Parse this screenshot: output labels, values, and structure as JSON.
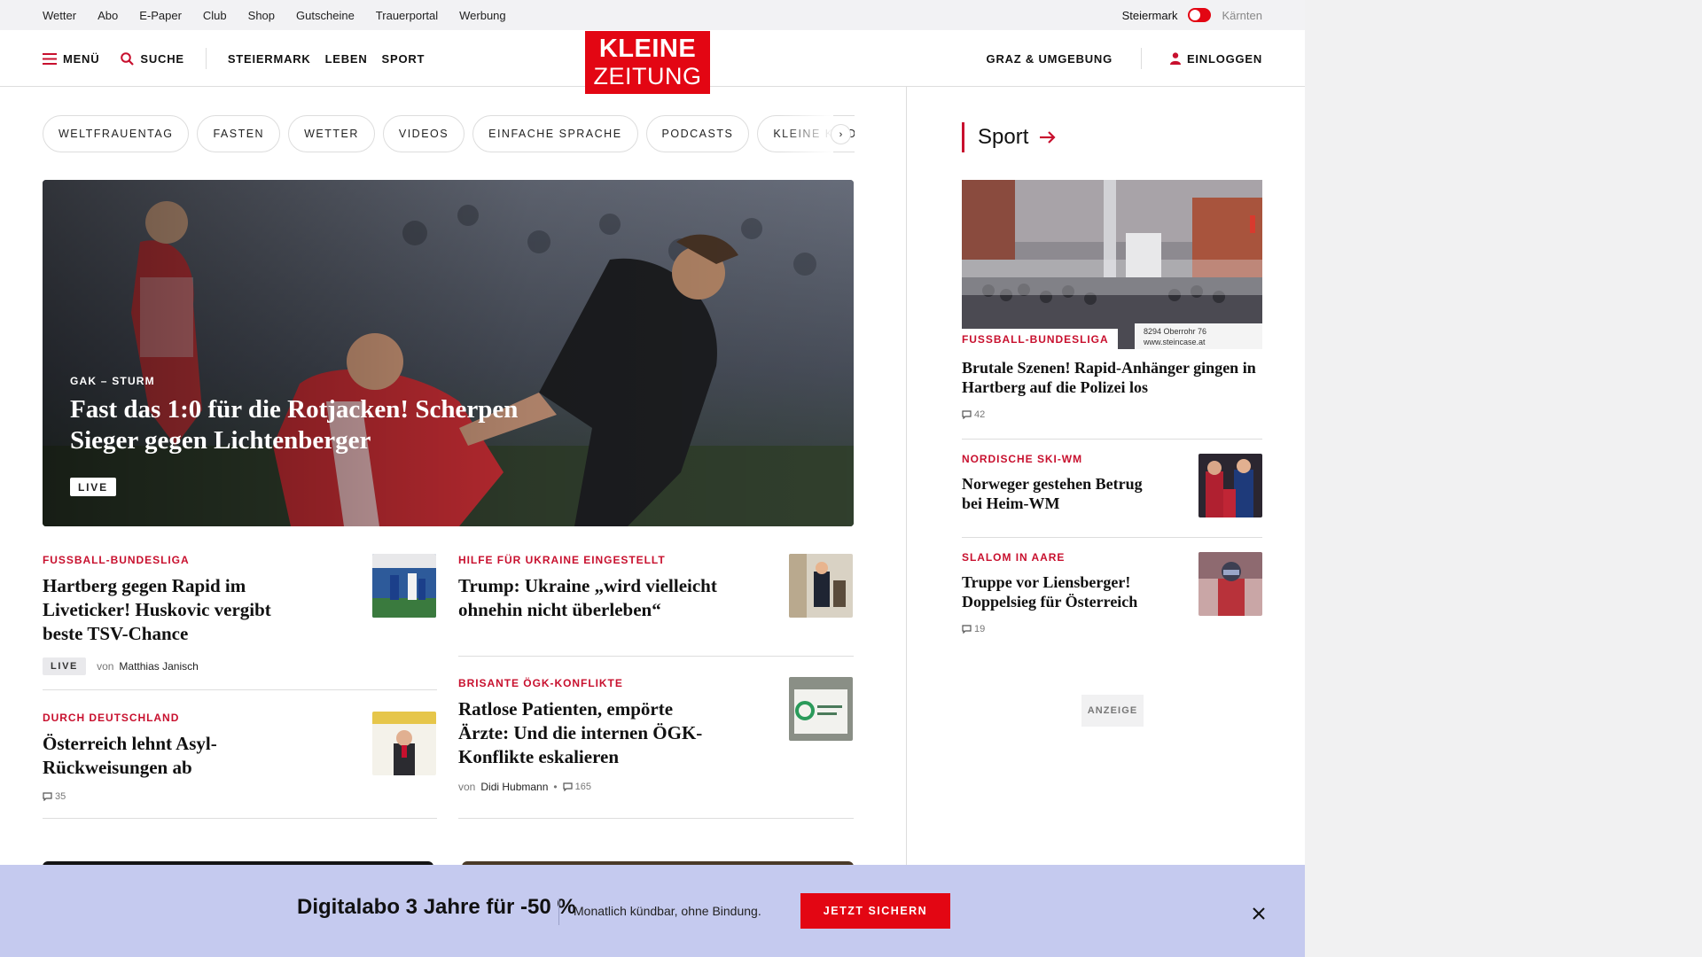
{
  "utility": {
    "links": [
      "Wetter",
      "Abo",
      "E-Paper",
      "Club",
      "Shop",
      "Gutscheine",
      "Trauerportal",
      "Werbung"
    ],
    "region_active": "Steiermark",
    "region_inactive": "Kärnten"
  },
  "header": {
    "menu": "MENÜ",
    "search": "SUCHE",
    "nav": [
      "STEIERMARK",
      "LEBEN",
      "SPORT"
    ],
    "logo_line1": "KLEINE",
    "logo_line2": "ZEITUNG",
    "region_link": "GRAZ & UMGEBUNG",
    "login": "EINLOGGEN"
  },
  "pills": [
    "WELTFRAUENTAG",
    "FASTEN",
    "WETTER",
    "VIDEOS",
    "EINFACHE SPRACHE",
    "PODCASTS",
    "KLEINE KINDERZEITUNG"
  ],
  "hero": {
    "kicker": "GAK – STURM",
    "title": "Fast das 1:0 für die Rotjacken! Scherpen Sieger gegen Lichtenberger",
    "badge": "LIVE"
  },
  "articles": {
    "a1": {
      "kicker": "FUSSBALL-BUNDESLIGA",
      "title": "Hartberg gegen Rapid im Liveticker! Huskovic vergibt beste TSV-Chance",
      "badge": "LIVE",
      "by": "von",
      "author": "Matthias Janisch"
    },
    "a2": {
      "kicker": "HILFE FÜR UKRAINE EINGESTELLT",
      "title": "Trump: Ukraine „wird vielleicht ohnehin nicht überleben“"
    },
    "a3": {
      "kicker": "DURCH DEUTSCHLAND",
      "title": "Österreich lehnt Asyl-Rückweisungen ab",
      "comments": "35"
    },
    "a4": {
      "kicker": "BRISANTE ÖGK-KONFLIKTE",
      "title": "Ratlose Patienten, empörte Ärzte: Und die internen ÖGK-Konflikte eskalieren",
      "by": "von",
      "author": "Didi Hubmann",
      "sep": "•",
      "comments": "165"
    }
  },
  "sidebar": {
    "section": "Sport",
    "s1": {
      "kicker": "FUSSBALL-BUNDESLIGA",
      "title": "Brutale Szenen! Rapid-Anhänger gingen in Hartberg auf die Polizei los",
      "comments": "42",
      "billboard": "8294 Oberrohr 76\nwww.steincase.at"
    },
    "s2": {
      "kicker": "NORDISCHE SKI-WM",
      "title": "Norweger gestehen Betrug bei Heim-WM"
    },
    "s3": {
      "kicker": "SLALOM IN AARE",
      "title": "Truppe vor Liensberger! Doppelsieg für Österreich",
      "comments": "19"
    },
    "ad_label": "ANZEIGE"
  },
  "promo": {
    "title": "Digitalabo 3 Jahre für -50 %",
    "subtitle": "Monatlich kündbar, ohne Bindung.",
    "button": "JETZT SICHERN"
  },
  "colors": {
    "brand_red": "#e30613",
    "kicker_red": "#c8102e",
    "promo_bg": "#c5caef"
  }
}
